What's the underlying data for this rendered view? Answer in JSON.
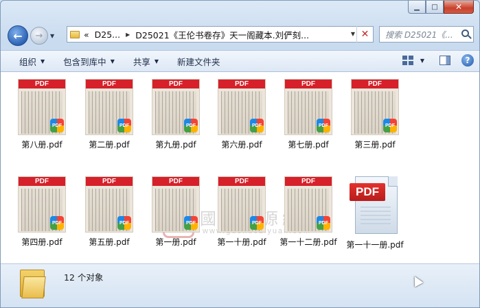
{
  "window": {
    "caption": {
      "minimize": "▁",
      "maximize": "□",
      "close": "✕"
    }
  },
  "nav": {
    "back_glyph": "←",
    "forward_glyph": "→",
    "address": {
      "prefix": "«",
      "crumb1": "D25...",
      "crumb2": "D25021《王伦书卷存》天一阁藏本.刘俨刻...",
      "drop_glyph": "▼",
      "clear_glyph": "✕"
    },
    "search": {
      "placeholder": "搜索 D25021《..."
    }
  },
  "toolbar": {
    "organize": "组织",
    "include_library": "包含到库中",
    "share": "共享",
    "new_folder": "新建文件夹",
    "help": "?"
  },
  "files": [
    {
      "name": "第八册.pdf",
      "thumb": "PDF",
      "badge": "PDF"
    },
    {
      "name": "第二册.pdf",
      "thumb": "PDF",
      "badge": "PDF"
    },
    {
      "name": "第九册.pdf",
      "thumb": "PDF",
      "badge": "PDF"
    },
    {
      "name": "第六册.pdf",
      "thumb": "PDF",
      "badge": "PDF"
    },
    {
      "name": "第七册.pdf",
      "thumb": "PDF",
      "badge": "PDF"
    },
    {
      "name": "第三册.pdf",
      "thumb": "PDF",
      "badge": "PDF"
    },
    {
      "name": "第四册.pdf",
      "thumb": "PDF",
      "badge": "PDF"
    },
    {
      "name": "第五册.pdf",
      "thumb": "PDF",
      "badge": "PDF"
    },
    {
      "name": "第一册.pdf",
      "thumb": "PDF",
      "badge": "PDF"
    },
    {
      "name": "第一十册.pdf",
      "thumb": "PDF",
      "badge": "PDF"
    },
    {
      "name": "第一十二册.pdf",
      "thumb": "PDF",
      "badge": "PDF"
    },
    {
      "name": "第一十一册.pdf",
      "thumb": "PDF"
    }
  ],
  "watermark": {
    "seal": "國",
    "chinese": "國學資源網",
    "url": "www.guoxueziyuan.com"
  },
  "status": {
    "count": "12 个对象"
  },
  "colors": {
    "pdf_red": "#d6202a",
    "accent_blue": "#2c63b5"
  }
}
